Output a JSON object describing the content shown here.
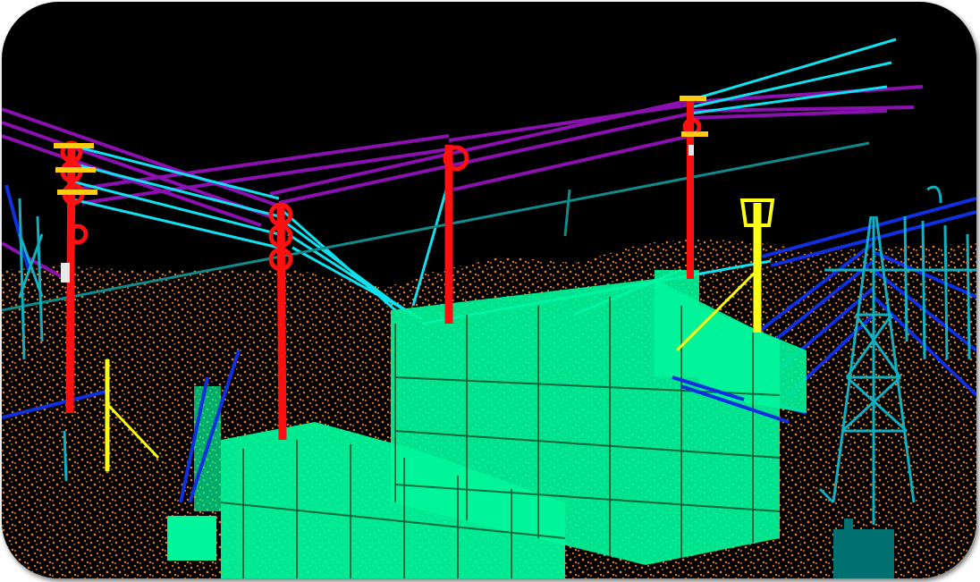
{
  "scene": {
    "background_color": "#000000",
    "classes": [
      {
        "name": "ground",
        "color": "#e07a1f"
      },
      {
        "name": "substation-equipment",
        "color": "#00f59a"
      },
      {
        "name": "pole",
        "color": "#ff1010"
      },
      {
        "name": "insulator",
        "color": "#ff1010"
      },
      {
        "name": "yellow-pole",
        "color": "#ffff10"
      },
      {
        "name": "purple-wire",
        "color": "#8a10b0"
      },
      {
        "name": "cyan-wire",
        "color": "#10e0f0"
      },
      {
        "name": "teal-wire",
        "color": "#108a8a"
      },
      {
        "name": "blue-wire",
        "color": "#1030e0"
      },
      {
        "name": "lattice-tower",
        "color": "#10b0c0"
      },
      {
        "name": "cabinet",
        "color": "#007070"
      }
    ]
  }
}
